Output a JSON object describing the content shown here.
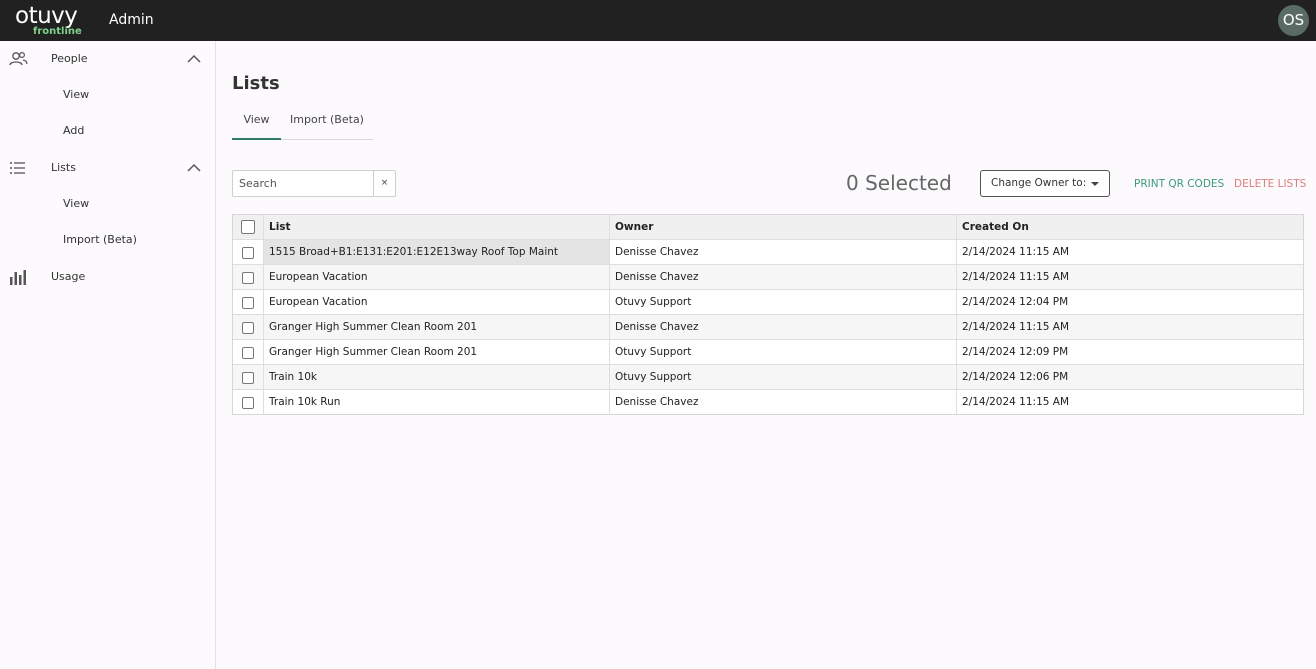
{
  "topbar": {
    "logo_text": "otuvy",
    "logo_sub": "frontline",
    "app_title": "Admin",
    "avatar_initials": "OS"
  },
  "sidebar": {
    "sections": [
      {
        "label": "People",
        "icon": "people-icon",
        "expanded": true,
        "children": [
          "View",
          "Add"
        ]
      },
      {
        "label": "Lists",
        "icon": "list-icon",
        "expanded": true,
        "children": [
          "View",
          "Import (Beta)"
        ]
      },
      {
        "label": "Usage",
        "icon": "bar-chart-icon",
        "expanded": false,
        "children": []
      }
    ]
  },
  "main": {
    "title": "Lists",
    "tabs": [
      {
        "label": "View",
        "active": true
      },
      {
        "label": "Import (Beta)",
        "active": false
      }
    ],
    "search": {
      "placeholder": "Search",
      "value": "",
      "clear_label": "×"
    },
    "selected_count": "0 Selected",
    "change_owner_label": "Change Owner to:",
    "print_label": "PRINT QR CODES",
    "delete_label": "DELETE LISTS",
    "colors": {
      "accent": "#2f7a66",
      "print": "#3d9a7a",
      "delete": "#e07b7b",
      "topbar": "#212121"
    }
  },
  "table": {
    "columns": [
      "List",
      "Owner",
      "Created On"
    ],
    "rows": [
      {
        "list": "1515 Broad+B1:E131:E201:E12E13way Roof Top Maint",
        "owner": "Denisse Chavez",
        "created": "2/14/2024 11:15 AM"
      },
      {
        "list": "European Vacation",
        "owner": "Denisse Chavez",
        "created": "2/14/2024 11:15 AM"
      },
      {
        "list": "European Vacation",
        "owner": "Otuvy Support",
        "created": "2/14/2024 12:04 PM"
      },
      {
        "list": "Granger High Summer Clean Room 201",
        "owner": "Denisse Chavez",
        "created": "2/14/2024 11:15 AM"
      },
      {
        "list": "Granger High Summer Clean Room 201",
        "owner": "Otuvy Support",
        "created": "2/14/2024 12:09 PM"
      },
      {
        "list": "Train 10k",
        "owner": "Otuvy Support",
        "created": "2/14/2024 12:06 PM"
      },
      {
        "list": "Train 10k Run",
        "owner": "Denisse Chavez",
        "created": "2/14/2024 11:15 AM"
      }
    ]
  }
}
